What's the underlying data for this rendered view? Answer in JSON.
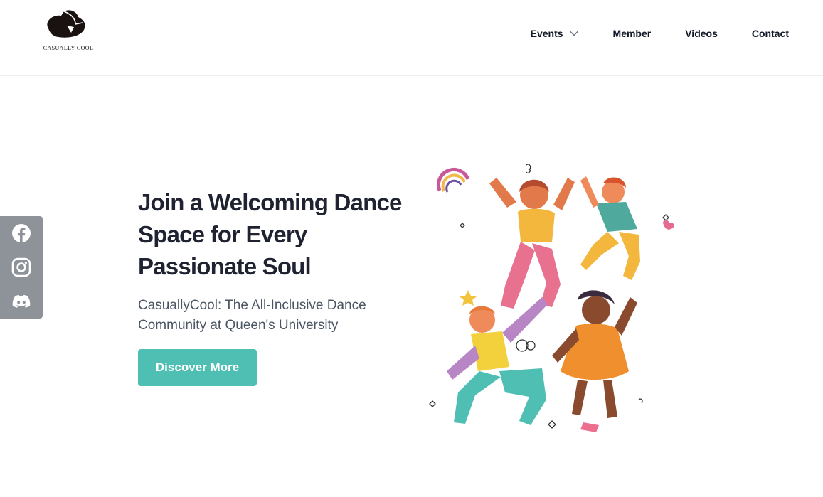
{
  "brand": {
    "logo_text": "CASUALLY COOL"
  },
  "nav": {
    "items": [
      {
        "label": "Events",
        "has_dropdown": true
      },
      {
        "label": "Member"
      },
      {
        "label": "Videos"
      },
      {
        "label": "Contact"
      }
    ]
  },
  "social": [
    {
      "name": "facebook-icon"
    },
    {
      "name": "instagram-icon"
    },
    {
      "name": "discord-icon"
    }
  ],
  "hero": {
    "title": "Join a Welcoming Dance Space for Every Passionate Soul",
    "subtitle": "CasuallyCool: The All-Inclusive Dance Community at Queen's University",
    "cta_label": "Discover More"
  },
  "colors": {
    "accent": "#4fbfb3",
    "sidebar": "#8e9299",
    "heading": "#1f2230",
    "subtext": "#4b5563"
  }
}
